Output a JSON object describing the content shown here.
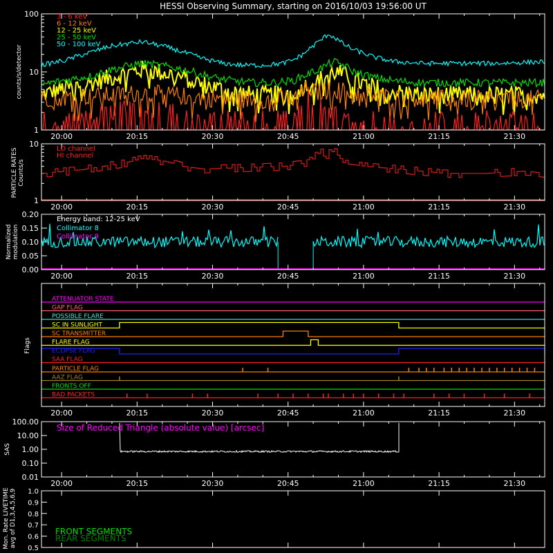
{
  "title": "HESSI Observing Summary, starting on 2016/10/03 19:56:00 UT",
  "time_axis": {
    "start_minutes": 0,
    "end_minutes": 100,
    "tick_minutes": [
      4,
      19,
      34,
      49,
      64,
      79,
      94
    ],
    "tick_labels": [
      "20:00",
      "20:15",
      "20:30",
      "20:45",
      "21:00",
      "21:15",
      "21:30"
    ]
  },
  "chart_data": [
    {
      "type": "line",
      "panel": "count-rates",
      "ylabel": "counts/s/detector",
      "yscale": "log",
      "ylim": [
        1,
        100
      ],
      "ytick_labels": [
        "1",
        "10",
        "100"
      ],
      "series": [
        {
          "name": "3 - 6 keV",
          "color": "#ff2020",
          "x": [
            0,
            10,
            14,
            20,
            26,
            30,
            34,
            38,
            42,
            46,
            50,
            52,
            53,
            54,
            55,
            56,
            58,
            62,
            66,
            70,
            76,
            82,
            90,
            100
          ],
          "y": [
            1,
            1,
            1.4,
            1.8,
            1.3,
            1,
            1,
            1,
            1,
            1,
            1,
            1.5,
            2.6,
            2.0,
            1.5,
            1.6,
            1.4,
            1,
            1,
            1,
            1,
            1,
            1,
            1
          ]
        },
        {
          "name": "6 - 12 keV",
          "color": "#ff8000",
          "x": [
            0,
            10,
            14,
            20,
            26,
            30,
            34,
            38,
            42,
            46,
            50,
            52,
            53,
            54,
            55,
            56,
            58,
            62,
            66,
            70,
            76,
            82,
            90,
            100
          ],
          "y": [
            3.5,
            3.8,
            4.0,
            4.3,
            4.0,
            3.7,
            3.5,
            3.4,
            3.3,
            3.3,
            3.6,
            4.2,
            6.0,
            4.6,
            4.4,
            4.6,
            5.0,
            4.4,
            3.9,
            3.6,
            3.5,
            3.4,
            3.4,
            3.4
          ]
        },
        {
          "name": "12 - 25 keV",
          "color": "#ffff00",
          "x": [
            0,
            10,
            14,
            20,
            26,
            30,
            34,
            38,
            42,
            46,
            50,
            52,
            54,
            56,
            58,
            60,
            62,
            66,
            70,
            76,
            82,
            90,
            100
          ],
          "y": [
            4,
            6.5,
            8,
            11,
            9,
            7,
            5.5,
            4.5,
            4,
            4,
            4.5,
            5.5,
            6.5,
            8,
            10,
            9,
            7,
            5.5,
            4.5,
            4,
            4,
            4,
            4
          ]
        },
        {
          "name": "25 - 50 keV",
          "color": "#00e000",
          "x": [
            0,
            10,
            14,
            20,
            26,
            30,
            34,
            38,
            42,
            46,
            50,
            52,
            54,
            56,
            58,
            60,
            62,
            66,
            70,
            76,
            82,
            90,
            100
          ],
          "y": [
            6,
            8.5,
            11,
            14,
            12,
            10,
            8,
            7,
            6.5,
            6.5,
            7,
            8.5,
            10,
            12,
            15,
            13,
            10,
            8,
            7,
            6.5,
            6.5,
            6.5,
            6.5
          ]
        },
        {
          "name": "50 - 100 keV",
          "color": "#00ffff",
          "x": [
            0,
            5,
            10,
            14,
            20,
            24,
            28,
            32,
            36,
            40,
            44,
            48,
            50,
            52,
            54,
            56,
            57,
            58,
            60,
            62,
            66,
            70,
            76,
            82,
            90,
            100
          ],
          "y": [
            13,
            16,
            22,
            28,
            33,
            28,
            22,
            17,
            14,
            13,
            13,
            14,
            16,
            20,
            28,
            38,
            45,
            40,
            30,
            24,
            18,
            15,
            14,
            14,
            14,
            15
          ]
        }
      ]
    },
    {
      "type": "line",
      "panel": "particle-rates",
      "ylabel": "PARTICLE RATES Counts/s",
      "yscale": "log",
      "ylim": [
        1,
        10
      ],
      "ytick_labels": [
        "1",
        "10"
      ],
      "series": [
        {
          "name": "LO channel",
          "color": "#ff2020",
          "x": [
            0,
            8,
            16,
            20,
            24,
            28,
            32,
            40,
            48,
            52,
            54,
            55,
            56,
            58,
            60,
            64,
            72,
            80,
            88,
            96,
            100
          ],
          "y": [
            3,
            3.5,
            4.5,
            5.5,
            5,
            4,
            3.6,
            3.8,
            4,
            4.5,
            6.5,
            8,
            6,
            7.5,
            4.5,
            4,
            3.5,
            3,
            3,
            3.3,
            3
          ]
        },
        {
          "name": "HI channel",
          "color": "#ff2020",
          "x": [
            0,
            100
          ],
          "y": [
            1,
            1
          ]
        }
      ]
    },
    {
      "type": "line",
      "panel": "modulation",
      "ylabel": "Normalized modulation",
      "ylim": [
        0,
        0.2
      ],
      "ytick_labels": [
        "0.00",
        "0.05",
        "0.10",
        "0.15",
        "0.20"
      ],
      "annotation": "Energy band: 12-25 keV",
      "series": [
        {
          "name": "Collimator 8",
          "color": "#00ffff",
          "segments": [
            [
              0,
              47
            ],
            [
              54,
              100
            ]
          ],
          "y_mean": 0.1
        },
        {
          "name": "Collimator 9",
          "color": "#ff00ff",
          "x": [
            0,
            100
          ],
          "y": [
            0,
            0
          ]
        }
      ]
    },
    {
      "type": "line",
      "panel": "flags",
      "ylabel": "Flags",
      "flags": [
        {
          "name": "ATTENUATOR STATE",
          "color": "#ff00ff",
          "on": []
        },
        {
          "name": "GAP FLAG",
          "color": "#ff6070",
          "on": []
        },
        {
          "name": "POSSIBLE FLARE",
          "color": "#40e0d0",
          "on": []
        },
        {
          "name": "SC IN SUNLIGHT",
          "color": "#ffff00",
          "on": [
            [
              15.5,
              71
            ]
          ]
        },
        {
          "name": "SC TRANSMITTER",
          "color": "#ff8000",
          "on": [
            [
              48,
              53
            ]
          ]
        },
        {
          "name": "FLARE FLAG",
          "color": "#ffff00",
          "on": [
            [
              53.5,
              55
            ]
          ]
        },
        {
          "name": "ECLIPSE FLAG",
          "color": "#2020ff",
          "on": [
            [
              0,
              15.5
            ],
            [
              71,
              100
            ]
          ]
        },
        {
          "name": "SAA FLAG",
          "color": "#ff2020",
          "on": []
        },
        {
          "name": "PARTICLE FLAG",
          "color": "#ff8000",
          "spikes": [
            40,
            45,
            73,
            75,
            76.5,
            78,
            80,
            81.5,
            83,
            84.5,
            86,
            87.5,
            89,
            90.5,
            92,
            93.5,
            95,
            96.5,
            98
          ]
        },
        {
          "name": "AAZ FLAG",
          "color": "#a08020",
          "spikes": [
            15.5,
            71
          ]
        },
        {
          "name": "FRONTS OFF",
          "color": "#00e000",
          "on": []
        },
        {
          "name": "BAD PACKETS",
          "color": "#ff2020",
          "spikes": [
            17,
            21,
            30,
            33,
            43,
            47,
            50,
            53,
            56,
            57,
            60,
            62,
            64,
            67,
            70,
            72,
            78,
            81,
            84,
            88,
            92,
            97
          ]
        }
      ]
    },
    {
      "type": "line",
      "panel": "sas",
      "ylabel": "SAS",
      "yscale": "log",
      "ylim": [
        0.01,
        100
      ],
      "ytick_labels": [
        "0.01",
        "0.10",
        "1.00",
        "10.00",
        "100.00"
      ],
      "annotation": "Size of Reduced Triangle (absolute value) [arcsec]",
      "series": [
        {
          "name": "",
          "color": "#ffffff",
          "segments": [
            [
              15.5,
              71
            ]
          ],
          "y_mean": 0.7
        }
      ]
    },
    {
      "type": "line",
      "panel": "livetime",
      "ylabel": "Mon. Rate LIVETIME avg of D1,3,4,5,6,9",
      "ylim": [
        0,
        1
      ],
      "ytick_labels": [
        "0.5",
        "0.6",
        "0.7",
        "0.8",
        "0.9",
        "1.0"
      ],
      "series": [
        {
          "name": "FRONT SEGMENTS",
          "color": "#00e000",
          "x": [],
          "y": []
        },
        {
          "name": "REAR SEGMENTS",
          "color": "#008000",
          "x": [],
          "y": []
        }
      ]
    }
  ]
}
